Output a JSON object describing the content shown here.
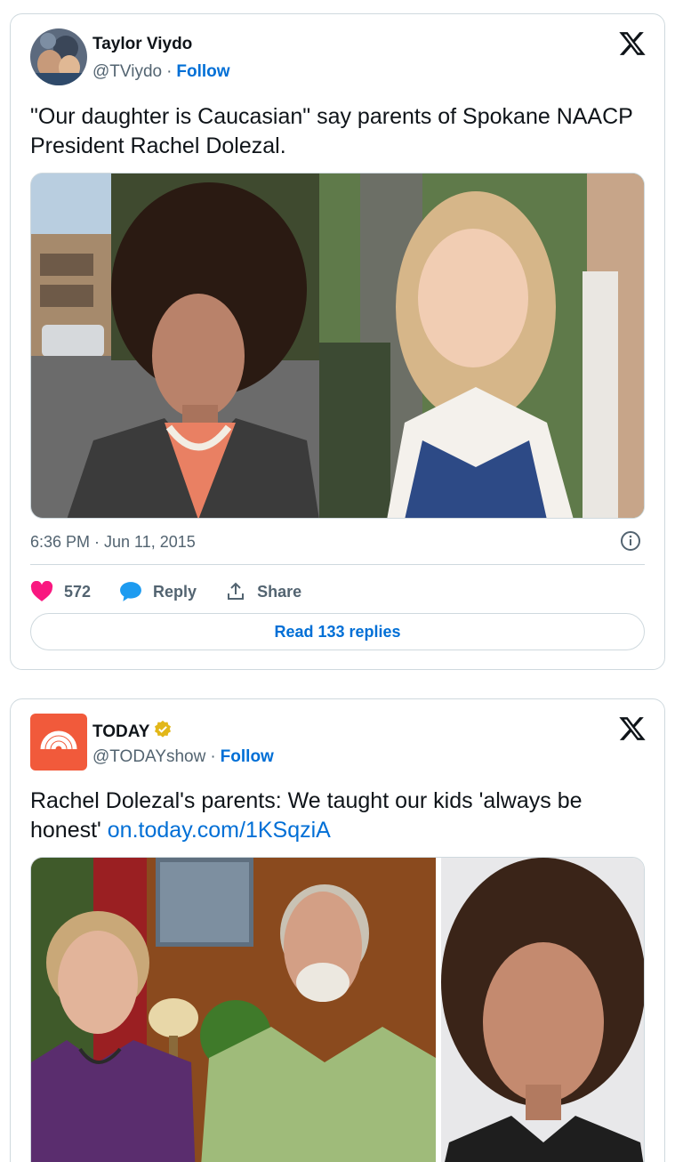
{
  "tweets": [
    {
      "author_name": "Taylor Viydo",
      "handle": "@TViydo",
      "separator": "·",
      "follow_label": "Follow",
      "text": "\"Our daughter is Caucasian\" say parents of Spokane NAACP President Rachel Dolezal.",
      "timestamp": "6:36 PM · Jun 11, 2015",
      "likes": "572",
      "reply_label": "Reply",
      "share_label": "Share",
      "read_replies_label": "Read 133 replies"
    },
    {
      "author_name": "TODAY",
      "verified": true,
      "handle": "@TODAYshow",
      "separator": "·",
      "follow_label": "Follow",
      "text": "Rachel Dolezal's parents: We taught our kids 'always be honest' ",
      "link_text": "on.today.com/1KSqziA"
    }
  ],
  "colors": {
    "accent": "#006fd6",
    "like": "#f91880",
    "reply_bubble": "#1d9bf0",
    "today_brand": "#f15a3b",
    "verified_gold": "#e2b719"
  },
  "icons": {
    "logo": "x-logo-icon",
    "info": "info-icon",
    "like": "heart-icon",
    "reply": "speech-bubble-icon",
    "share": "share-upload-icon",
    "verified": "verified-badge-icon"
  }
}
